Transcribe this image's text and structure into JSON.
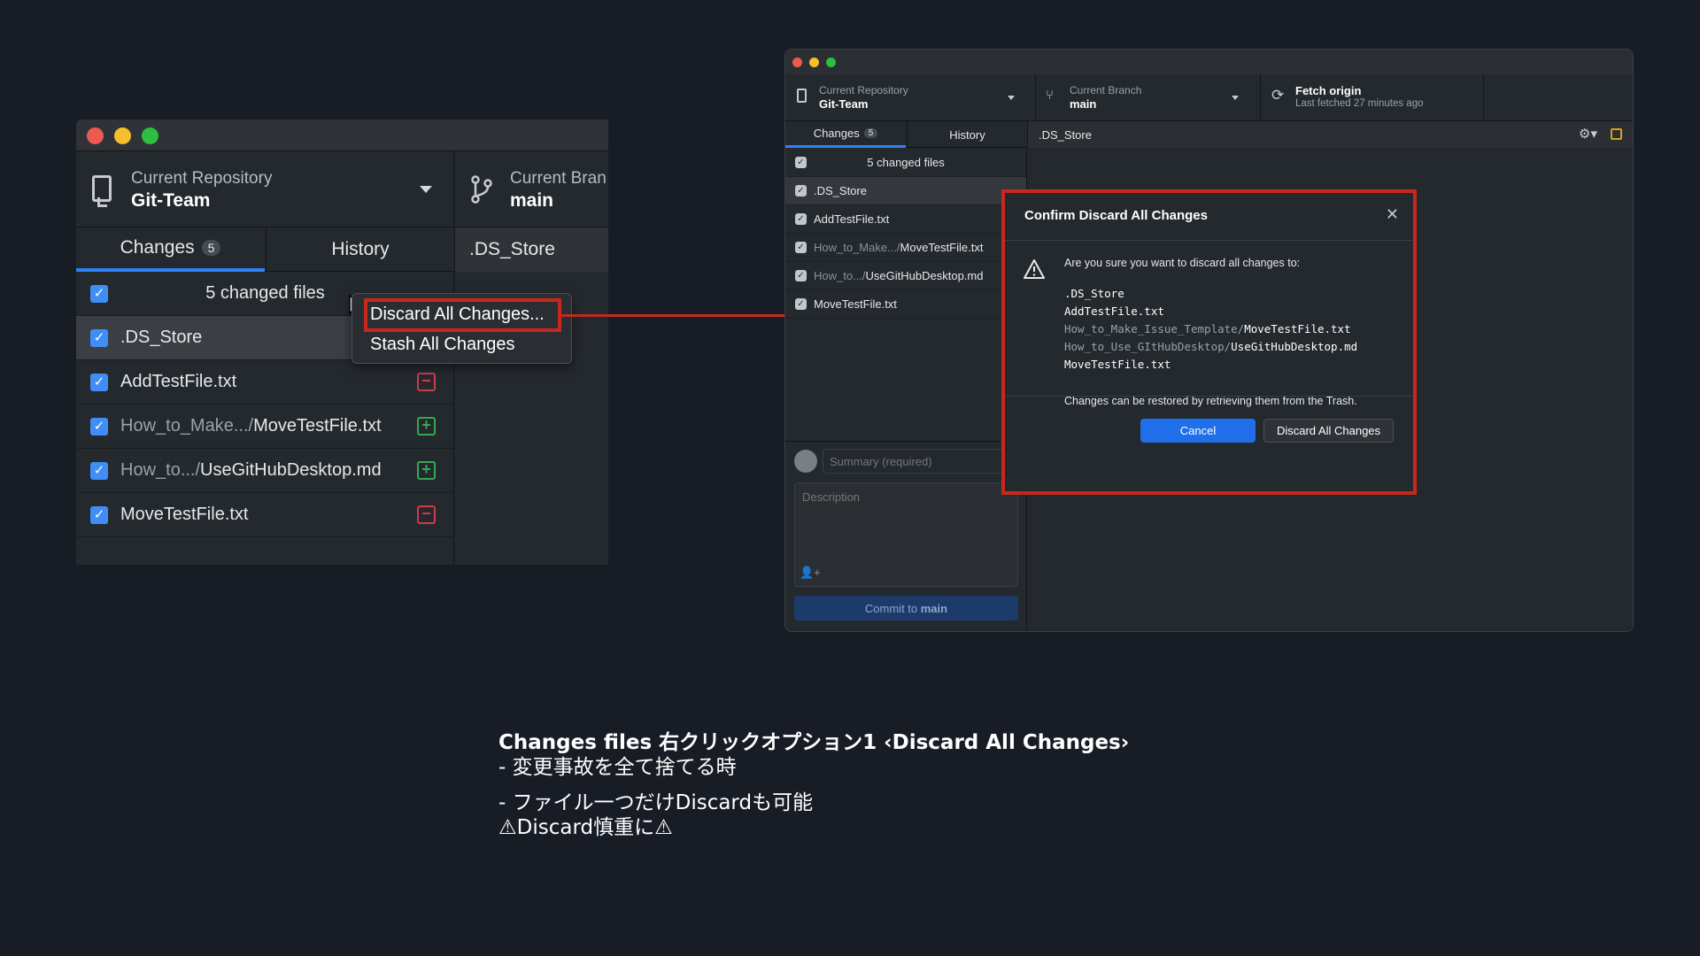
{
  "left_window": {
    "repo_label": "Current Repository",
    "repo_name": "Git-Team",
    "branch_label": "Current Bran",
    "branch_name": "main",
    "tabs": {
      "changes": "Changes",
      "changes_count": "5",
      "history": "History",
      "file": ".DS_Store"
    },
    "header_text": "5 changed files",
    "files": [
      {
        "prefix": "",
        "name": ".DS_Store",
        "status": ""
      },
      {
        "prefix": "",
        "name": "AddTestFile.txt",
        "status": "deleted"
      },
      {
        "prefix": "How_to_Make.../",
        "name": "MoveTestFile.txt",
        "status": "added"
      },
      {
        "prefix": "How_to.../",
        "name": "UseGitHubDesktop.md",
        "status": "added"
      },
      {
        "prefix": "",
        "name": "MoveTestFile.txt",
        "status": "deleted"
      }
    ],
    "context_menu": {
      "discard": "Discard All Changes...",
      "stash": "Stash All Changes"
    }
  },
  "right_window": {
    "repo_label": "Current Repository",
    "repo_name": "Git-Team",
    "branch_label": "Current Branch",
    "branch_name": "main",
    "fetch_label": "Fetch origin",
    "fetch_sub": "Last fetched 27 minutes ago",
    "tabs": {
      "changes": "Changes",
      "changes_count": "5",
      "history": "History",
      "file": ".DS_Store"
    },
    "header_text": "5 changed files",
    "files": [
      {
        "prefix": "",
        "name": ".DS_Store"
      },
      {
        "prefix": "",
        "name": "AddTestFile.txt"
      },
      {
        "prefix": "How_to_Make.../",
        "name": "MoveTestFile.txt"
      },
      {
        "prefix": "How_to.../",
        "name": "UseGitHubDesktop.md"
      },
      {
        "prefix": "",
        "name": "MoveTestFile.txt"
      }
    ],
    "summary_placeholder": "Summary (required)",
    "description_placeholder": "Description",
    "commit_prefix": "Commit to ",
    "commit_branch": "main"
  },
  "dialog": {
    "title": "Confirm Discard All Changes",
    "message": "Are you sure you want to discard all changes to:",
    "files": [
      {
        "dir": "",
        "name": ".DS_Store"
      },
      {
        "dir": "",
        "name": "AddTestFile.txt"
      },
      {
        "dir": "How_to_Make_Issue_Template/",
        "name": "MoveTestFile.txt"
      },
      {
        "dir": "How_to_Use_GItHubDesktop/",
        "name": "UseGitHubDesktop.md"
      },
      {
        "dir": "",
        "name": "MoveTestFile.txt"
      }
    ],
    "note": "Changes can be restored by retrieving them from the Trash.",
    "cancel": "Cancel",
    "confirm": "Discard All Changes"
  },
  "caption": {
    "line1": "Changes files 右クリックオプション1 ‹Discard All Changes›",
    "line2": "- 変更事故を全て捨てる時",
    "line3": "- ファイル一つだけDiscardも可能",
    "line4": "⚠Discard慎重に⚠"
  },
  "colors": {
    "accent_blue": "#2f81f7",
    "highlight_red": "#c6281e",
    "background": "#181c25"
  }
}
